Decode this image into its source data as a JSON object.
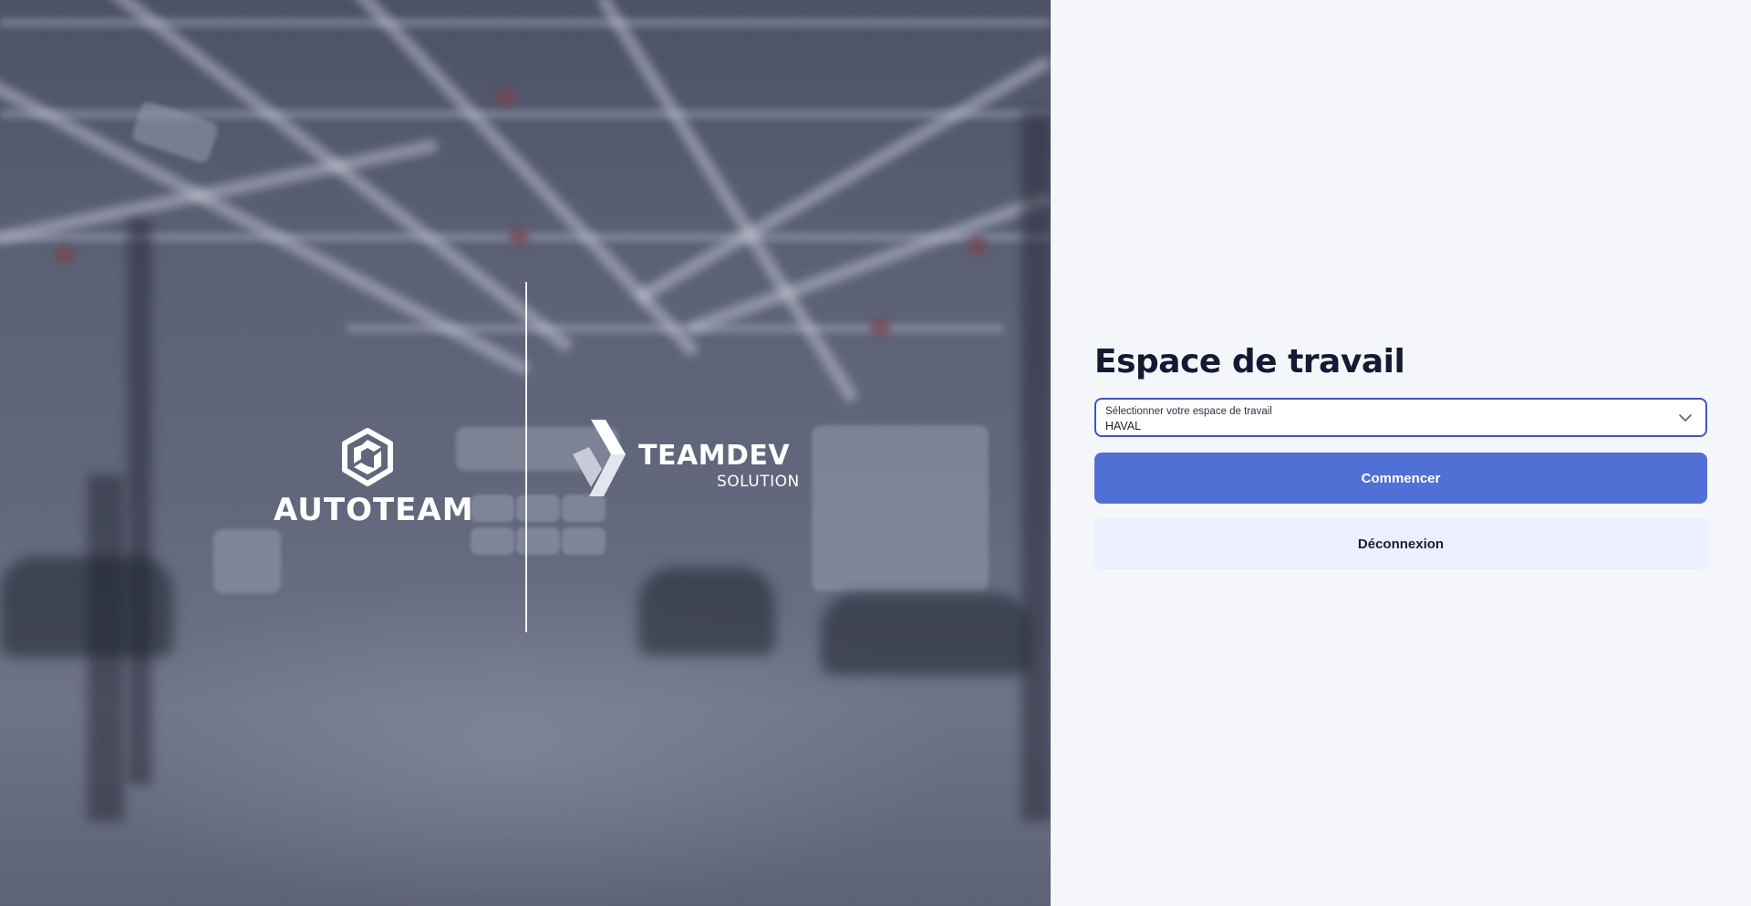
{
  "hero": {
    "logo_left": {
      "name": "AUTOTEAM",
      "icon": "autoteam-hexagon-logo-icon"
    },
    "logo_right": {
      "name": "TEAMDEV",
      "subtitle": "SOLUTION",
      "icon": "teamdev-chevron-logo-icon"
    }
  },
  "workspace": {
    "title": "Espace de travail",
    "select": {
      "label": "Sélectionner votre espace de travail",
      "value": "HAVAL",
      "icon": "chevron-down-icon"
    },
    "start_button": "Commencer",
    "logout_button": "Déconnexion"
  },
  "colors": {
    "accent": "#5070d6",
    "select_border": "#3f55c4",
    "secondary_button_bg": "#eceffd",
    "title": "#141a33",
    "panel_bg": "#f5f6f9"
  }
}
